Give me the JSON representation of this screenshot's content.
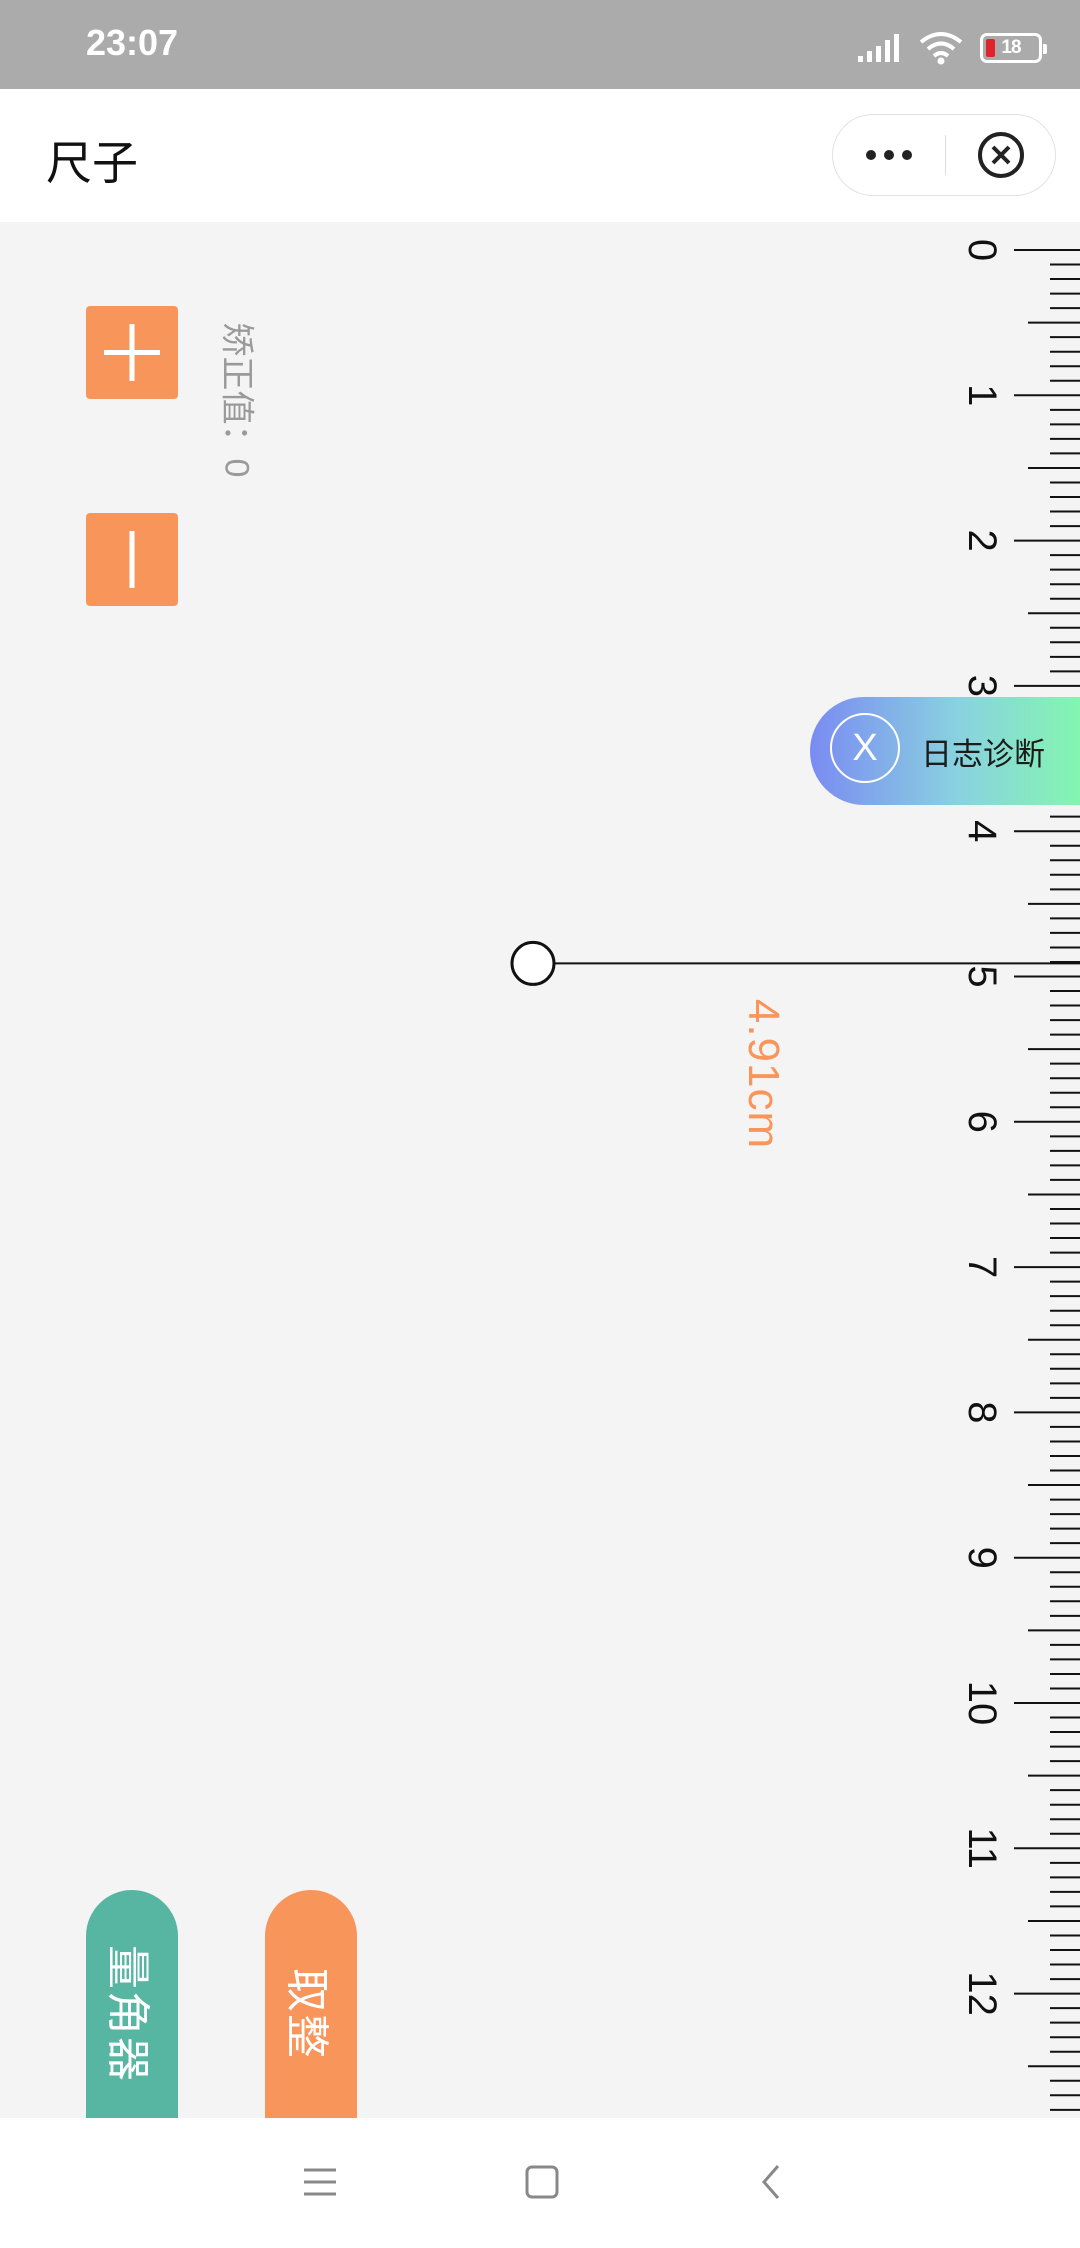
{
  "status_bar": {
    "time": "23:07",
    "battery": "18"
  },
  "title_bar": {
    "title": "尺子"
  },
  "ruler": {
    "unit": "cm",
    "tick_labels": [
      "0",
      "1",
      "2",
      "3",
      "4",
      "5",
      "6",
      "7",
      "8",
      "9",
      "10",
      "11",
      "12"
    ],
    "correction_label": "矫正值：0",
    "measurement": "4.91cm",
    "measurement_value": 4.91
  },
  "buttons": {
    "plus_symbol": "+",
    "minus_symbol": "−",
    "protractor": "量角器",
    "round": "取整"
  },
  "log_diagnosis": {
    "icon_label": "X",
    "label": "日志诊断"
  },
  "colors": {
    "accent": "#f8955a",
    "teal": "#57b6a1",
    "status_bar": "#ababab"
  }
}
